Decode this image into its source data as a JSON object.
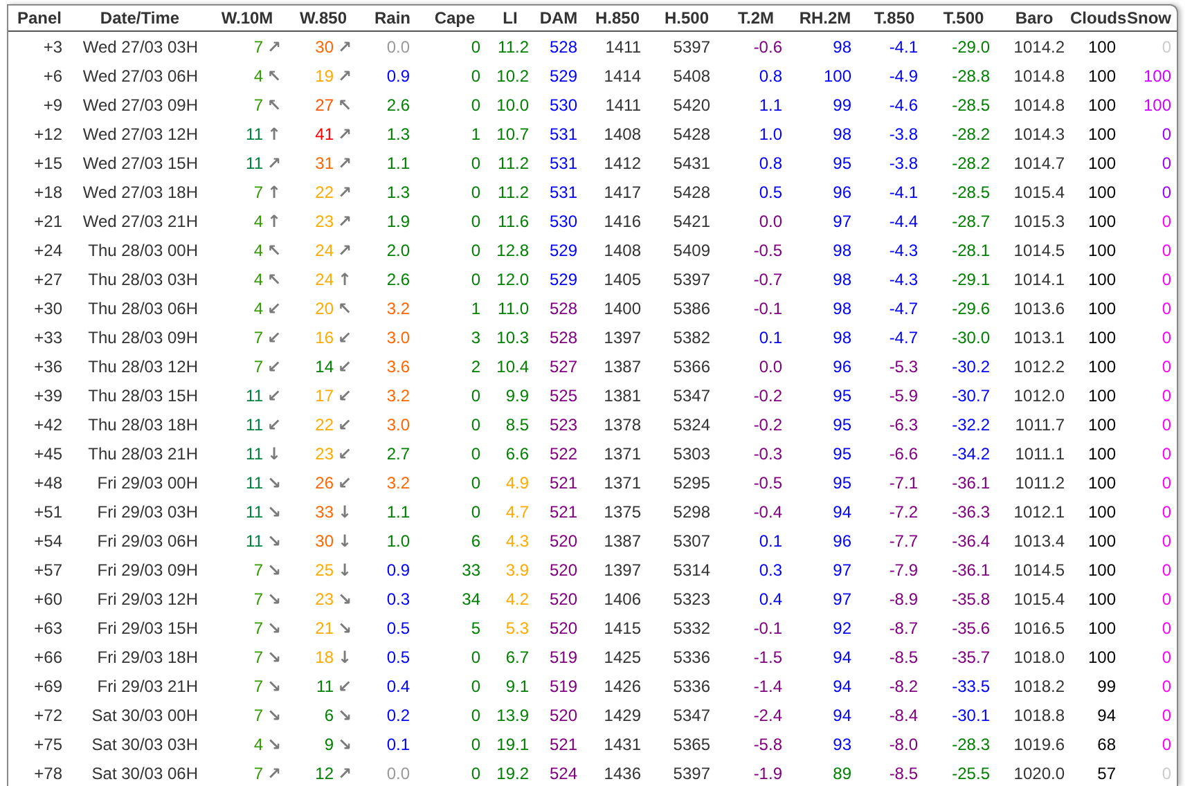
{
  "table": {
    "columns": [
      {
        "label": "Panel",
        "kind": "text"
      },
      {
        "label": "Date/Time",
        "kind": "text"
      },
      {
        "label": "W.10M",
        "kind": "wind"
      },
      {
        "label": "W.850",
        "kind": "wind"
      },
      {
        "label": "Rain",
        "kind": "text"
      },
      {
        "label": "Cape",
        "kind": "text"
      },
      {
        "label": "LI",
        "kind": "text"
      },
      {
        "label": "DAM",
        "kind": "text"
      },
      {
        "label": "H.850",
        "kind": "text"
      },
      {
        "label": "H.500",
        "kind": "text"
      },
      {
        "label": "T.2M",
        "kind": "text"
      },
      {
        "label": "RH.2M",
        "kind": "text"
      },
      {
        "label": "T.850",
        "kind": "text"
      },
      {
        "label": "T.500",
        "kind": "text"
      },
      {
        "label": "Baro",
        "kind": "text"
      },
      {
        "label": "Clouds",
        "kind": "text"
      },
      {
        "label": "Snow",
        "kind": "text"
      }
    ],
    "rows": [
      {
        "cells": [
          {
            "text": "+3"
          },
          {
            "text": "Wed 27/03 03H"
          },
          {
            "text": "7",
            "color": "#339900",
            "arrow": "↗"
          },
          {
            "text": "30",
            "color": "#ff6600",
            "arrow": "↗"
          },
          {
            "text": "0.0",
            "color": "#999999"
          },
          {
            "text": "0",
            "color": "#008000"
          },
          {
            "text": "11.2",
            "color": "#008000"
          },
          {
            "text": "528",
            "color": "#0000ff"
          },
          {
            "text": "1411"
          },
          {
            "text": "5397"
          },
          {
            "text": "-0.6",
            "color": "#800080"
          },
          {
            "text": "98",
            "color": "#0000ff"
          },
          {
            "text": "-4.1",
            "color": "#0000ff"
          },
          {
            "text": "-29.0",
            "color": "#008000"
          },
          {
            "text": "1014.2"
          },
          {
            "text": "100"
          },
          {
            "text": "0",
            "color": "#cccccc"
          }
        ]
      },
      {
        "cells": [
          {
            "text": "+6"
          },
          {
            "text": "Wed 27/03 06H"
          },
          {
            "text": "4",
            "color": "#339900",
            "arrow": "↖"
          },
          {
            "text": "19",
            "color": "#ffaa00",
            "arrow": "↗"
          },
          {
            "text": "0.9",
            "color": "#0000ff"
          },
          {
            "text": "0",
            "color": "#008000"
          },
          {
            "text": "10.2",
            "color": "#008000"
          },
          {
            "text": "529",
            "color": "#0000ff"
          },
          {
            "text": "1414"
          },
          {
            "text": "5408"
          },
          {
            "text": "0.8",
            "color": "#0000ff"
          },
          {
            "text": "100",
            "color": "#0000ff"
          },
          {
            "text": "-4.9",
            "color": "#0000ff"
          },
          {
            "text": "-28.8",
            "color": "#008000"
          },
          {
            "text": "1014.8"
          },
          {
            "text": "100"
          },
          {
            "text": "100",
            "color": "#cc00ff"
          }
        ]
      },
      {
        "cells": [
          {
            "text": "+9"
          },
          {
            "text": "Wed 27/03 09H"
          },
          {
            "text": "7",
            "color": "#339900",
            "arrow": "↖"
          },
          {
            "text": "27",
            "color": "#ff5500",
            "arrow": "↖"
          },
          {
            "text": "2.6",
            "color": "#008000"
          },
          {
            "text": "0",
            "color": "#008000"
          },
          {
            "text": "10.0",
            "color": "#008000"
          },
          {
            "text": "530",
            "color": "#0000ff"
          },
          {
            "text": "1411"
          },
          {
            "text": "5420"
          },
          {
            "text": "1.1",
            "color": "#0000ff"
          },
          {
            "text": "99",
            "color": "#0000ff"
          },
          {
            "text": "-4.6",
            "color": "#0000ff"
          },
          {
            "text": "-28.5",
            "color": "#008000"
          },
          {
            "text": "1014.8"
          },
          {
            "text": "100"
          },
          {
            "text": "100",
            "color": "#cc00ff"
          }
        ]
      },
      {
        "cells": [
          {
            "text": "+12"
          },
          {
            "text": "Wed 27/03 12H"
          },
          {
            "text": "11",
            "color": "#008040",
            "arrow": "↑"
          },
          {
            "text": "41",
            "color": "#ff0000",
            "arrow": "↗"
          },
          {
            "text": "1.3",
            "color": "#008000"
          },
          {
            "text": "1",
            "color": "#008000"
          },
          {
            "text": "10.7",
            "color": "#008000"
          },
          {
            "text": "531",
            "color": "#0000ff"
          },
          {
            "text": "1408"
          },
          {
            "text": "5428"
          },
          {
            "text": "1.0",
            "color": "#0000ff"
          },
          {
            "text": "98",
            "color": "#0000ff"
          },
          {
            "text": "-3.8",
            "color": "#0000ff"
          },
          {
            "text": "-28.2",
            "color": "#008000"
          },
          {
            "text": "1014.3"
          },
          {
            "text": "100"
          },
          {
            "text": "0",
            "color": "#a000ff"
          }
        ]
      },
      {
        "cells": [
          {
            "text": "+15"
          },
          {
            "text": "Wed 27/03 15H"
          },
          {
            "text": "11",
            "color": "#008040",
            "arrow": "↗"
          },
          {
            "text": "31",
            "color": "#ff6600",
            "arrow": "↗"
          },
          {
            "text": "1.1",
            "color": "#008000"
          },
          {
            "text": "0",
            "color": "#008000"
          },
          {
            "text": "11.2",
            "color": "#008000"
          },
          {
            "text": "531",
            "color": "#0000ff"
          },
          {
            "text": "1412"
          },
          {
            "text": "5431"
          },
          {
            "text": "0.8",
            "color": "#0000ff"
          },
          {
            "text": "95",
            "color": "#0000ff"
          },
          {
            "text": "-3.8",
            "color": "#0000ff"
          },
          {
            "text": "-28.2",
            "color": "#008000"
          },
          {
            "text": "1014.7"
          },
          {
            "text": "100"
          },
          {
            "text": "0",
            "color": "#a000ff"
          }
        ]
      },
      {
        "cells": [
          {
            "text": "+18"
          },
          {
            "text": "Wed 27/03 18H"
          },
          {
            "text": "7",
            "color": "#339900",
            "arrow": "↑"
          },
          {
            "text": "22",
            "color": "#ffaa00",
            "arrow": "↗"
          },
          {
            "text": "1.3",
            "color": "#008000"
          },
          {
            "text": "0",
            "color": "#008000"
          },
          {
            "text": "11.2",
            "color": "#008000"
          },
          {
            "text": "531",
            "color": "#0000ff"
          },
          {
            "text": "1417"
          },
          {
            "text": "5428"
          },
          {
            "text": "0.5",
            "color": "#0000ff"
          },
          {
            "text": "96",
            "color": "#0000ff"
          },
          {
            "text": "-4.1",
            "color": "#0000ff"
          },
          {
            "text": "-28.5",
            "color": "#008000"
          },
          {
            "text": "1015.4"
          },
          {
            "text": "100"
          },
          {
            "text": "0",
            "color": "#a000ff"
          }
        ]
      },
      {
        "cells": [
          {
            "text": "+21"
          },
          {
            "text": "Wed 27/03 21H"
          },
          {
            "text": "4",
            "color": "#339900",
            "arrow": "↑"
          },
          {
            "text": "23",
            "color": "#ffaa00",
            "arrow": "↗"
          },
          {
            "text": "1.9",
            "color": "#008000"
          },
          {
            "text": "0",
            "color": "#008000"
          },
          {
            "text": "11.6",
            "color": "#008000"
          },
          {
            "text": "530",
            "color": "#0000ff"
          },
          {
            "text": "1416"
          },
          {
            "text": "5421"
          },
          {
            "text": "0.0",
            "color": "#800080"
          },
          {
            "text": "97",
            "color": "#0000ff"
          },
          {
            "text": "-4.4",
            "color": "#0000ff"
          },
          {
            "text": "-28.7",
            "color": "#008000"
          },
          {
            "text": "1015.3"
          },
          {
            "text": "100"
          },
          {
            "text": "0",
            "color": "#ff00ff"
          }
        ]
      },
      {
        "cells": [
          {
            "text": "+24"
          },
          {
            "text": "Thu 28/03 00H"
          },
          {
            "text": "4",
            "color": "#339900",
            "arrow": "↖"
          },
          {
            "text": "24",
            "color": "#ffaa00",
            "arrow": "↗"
          },
          {
            "text": "2.0",
            "color": "#008000"
          },
          {
            "text": "0",
            "color": "#008000"
          },
          {
            "text": "12.8",
            "color": "#008000"
          },
          {
            "text": "529",
            "color": "#0000ff"
          },
          {
            "text": "1408"
          },
          {
            "text": "5409"
          },
          {
            "text": "-0.5",
            "color": "#800080"
          },
          {
            "text": "98",
            "color": "#0000ff"
          },
          {
            "text": "-4.3",
            "color": "#0000ff"
          },
          {
            "text": "-28.1",
            "color": "#008000"
          },
          {
            "text": "1014.5"
          },
          {
            "text": "100"
          },
          {
            "text": "0",
            "color": "#ff00ff"
          }
        ]
      },
      {
        "cells": [
          {
            "text": "+27"
          },
          {
            "text": "Thu 28/03 03H"
          },
          {
            "text": "4",
            "color": "#339900",
            "arrow": "↖"
          },
          {
            "text": "24",
            "color": "#ffaa00",
            "arrow": "↑"
          },
          {
            "text": "2.6",
            "color": "#008000"
          },
          {
            "text": "0",
            "color": "#008000"
          },
          {
            "text": "12.0",
            "color": "#008000"
          },
          {
            "text": "529",
            "color": "#0000ff"
          },
          {
            "text": "1405"
          },
          {
            "text": "5397"
          },
          {
            "text": "-0.7",
            "color": "#800080"
          },
          {
            "text": "98",
            "color": "#0000ff"
          },
          {
            "text": "-4.3",
            "color": "#0000ff"
          },
          {
            "text": "-29.1",
            "color": "#008000"
          },
          {
            "text": "1014.1"
          },
          {
            "text": "100"
          },
          {
            "text": "0",
            "color": "#ff00ff"
          }
        ]
      },
      {
        "cells": [
          {
            "text": "+30"
          },
          {
            "text": "Thu 28/03 06H"
          },
          {
            "text": "4",
            "color": "#339900",
            "arrow": "↙"
          },
          {
            "text": "20",
            "color": "#ffaa00",
            "arrow": "↖"
          },
          {
            "text": "3.2",
            "color": "#ff6600"
          },
          {
            "text": "1",
            "color": "#008000"
          },
          {
            "text": "11.0",
            "color": "#008000"
          },
          {
            "text": "528",
            "color": "#800080"
          },
          {
            "text": "1400"
          },
          {
            "text": "5386"
          },
          {
            "text": "-0.1",
            "color": "#800080"
          },
          {
            "text": "98",
            "color": "#0000ff"
          },
          {
            "text": "-4.7",
            "color": "#0000ff"
          },
          {
            "text": "-29.6",
            "color": "#008000"
          },
          {
            "text": "1013.6"
          },
          {
            "text": "100"
          },
          {
            "text": "0",
            "color": "#ff00ff"
          }
        ]
      },
      {
        "cells": [
          {
            "text": "+33"
          },
          {
            "text": "Thu 28/03 09H"
          },
          {
            "text": "7",
            "color": "#339900",
            "arrow": "↙"
          },
          {
            "text": "16",
            "color": "#ffaa00",
            "arrow": "↙"
          },
          {
            "text": "3.0",
            "color": "#ff6600"
          },
          {
            "text": "3",
            "color": "#008000"
          },
          {
            "text": "10.3",
            "color": "#008000"
          },
          {
            "text": "528",
            "color": "#800080"
          },
          {
            "text": "1397"
          },
          {
            "text": "5382"
          },
          {
            "text": "0.1",
            "color": "#0000ff"
          },
          {
            "text": "98",
            "color": "#0000ff"
          },
          {
            "text": "-4.7",
            "color": "#0000ff"
          },
          {
            "text": "-30.0",
            "color": "#008000"
          },
          {
            "text": "1013.1"
          },
          {
            "text": "100"
          },
          {
            "text": "0",
            "color": "#ff00ff"
          }
        ]
      },
      {
        "cells": [
          {
            "text": "+36"
          },
          {
            "text": "Thu 28/03 12H"
          },
          {
            "text": "7",
            "color": "#339900",
            "arrow": "↙"
          },
          {
            "text": "14",
            "color": "#008000",
            "arrow": "↙"
          },
          {
            "text": "3.6",
            "color": "#ff6600"
          },
          {
            "text": "2",
            "color": "#008000"
          },
          {
            "text": "10.4",
            "color": "#008000"
          },
          {
            "text": "527",
            "color": "#800080"
          },
          {
            "text": "1387"
          },
          {
            "text": "5366"
          },
          {
            "text": "0.0",
            "color": "#800080"
          },
          {
            "text": "96",
            "color": "#0000ff"
          },
          {
            "text": "-5.3",
            "color": "#800080"
          },
          {
            "text": "-30.2",
            "color": "#0000ff"
          },
          {
            "text": "1012.2"
          },
          {
            "text": "100"
          },
          {
            "text": "0",
            "color": "#ff00ff"
          }
        ]
      },
      {
        "cells": [
          {
            "text": "+39"
          },
          {
            "text": "Thu 28/03 15H"
          },
          {
            "text": "11",
            "color": "#008040",
            "arrow": "↙"
          },
          {
            "text": "17",
            "color": "#ffaa00",
            "arrow": "↙"
          },
          {
            "text": "3.2",
            "color": "#ff6600"
          },
          {
            "text": "0",
            "color": "#008000"
          },
          {
            "text": "9.9",
            "color": "#008000"
          },
          {
            "text": "525",
            "color": "#800080"
          },
          {
            "text": "1381"
          },
          {
            "text": "5347"
          },
          {
            "text": "-0.2",
            "color": "#800080"
          },
          {
            "text": "95",
            "color": "#0000ff"
          },
          {
            "text": "-5.9",
            "color": "#800080"
          },
          {
            "text": "-30.7",
            "color": "#0000ff"
          },
          {
            "text": "1012.0"
          },
          {
            "text": "100"
          },
          {
            "text": "0",
            "color": "#ff00ff"
          }
        ]
      },
      {
        "cells": [
          {
            "text": "+42"
          },
          {
            "text": "Thu 28/03 18H"
          },
          {
            "text": "11",
            "color": "#008040",
            "arrow": "↙"
          },
          {
            "text": "22",
            "color": "#ffaa00",
            "arrow": "↙"
          },
          {
            "text": "3.0",
            "color": "#ff6600"
          },
          {
            "text": "0",
            "color": "#008000"
          },
          {
            "text": "8.5",
            "color": "#008000"
          },
          {
            "text": "523",
            "color": "#800080"
          },
          {
            "text": "1378"
          },
          {
            "text": "5324"
          },
          {
            "text": "-0.2",
            "color": "#800080"
          },
          {
            "text": "95",
            "color": "#0000ff"
          },
          {
            "text": "-6.3",
            "color": "#800080"
          },
          {
            "text": "-32.2",
            "color": "#0000ff"
          },
          {
            "text": "1011.7"
          },
          {
            "text": "100"
          },
          {
            "text": "0",
            "color": "#ff00ff"
          }
        ]
      },
      {
        "cells": [
          {
            "text": "+45"
          },
          {
            "text": "Thu 28/03 21H"
          },
          {
            "text": "11",
            "color": "#008040",
            "arrow": "↓"
          },
          {
            "text": "23",
            "color": "#ffaa00",
            "arrow": "↙"
          },
          {
            "text": "2.7",
            "color": "#008000"
          },
          {
            "text": "0",
            "color": "#008000"
          },
          {
            "text": "6.6",
            "color": "#008000"
          },
          {
            "text": "522",
            "color": "#800080"
          },
          {
            "text": "1371"
          },
          {
            "text": "5303"
          },
          {
            "text": "-0.3",
            "color": "#800080"
          },
          {
            "text": "95",
            "color": "#0000ff"
          },
          {
            "text": "-6.6",
            "color": "#800080"
          },
          {
            "text": "-34.2",
            "color": "#0000ff"
          },
          {
            "text": "1011.1"
          },
          {
            "text": "100"
          },
          {
            "text": "0",
            "color": "#ff00ff"
          }
        ]
      },
      {
        "cells": [
          {
            "text": "+48"
          },
          {
            "text": "Fri 29/03 00H"
          },
          {
            "text": "11",
            "color": "#008040",
            "arrow": "↘"
          },
          {
            "text": "26",
            "color": "#ff6600",
            "arrow": "↙"
          },
          {
            "text": "3.2",
            "color": "#ff6600"
          },
          {
            "text": "0",
            "color": "#008000"
          },
          {
            "text": "4.9",
            "color": "#ffaa00"
          },
          {
            "text": "521",
            "color": "#800080"
          },
          {
            "text": "1371"
          },
          {
            "text": "5295"
          },
          {
            "text": "-0.5",
            "color": "#800080"
          },
          {
            "text": "95",
            "color": "#0000ff"
          },
          {
            "text": "-7.1",
            "color": "#800080"
          },
          {
            "text": "-36.1",
            "color": "#800080"
          },
          {
            "text": "1011.2"
          },
          {
            "text": "100"
          },
          {
            "text": "0",
            "color": "#ff00ff"
          }
        ]
      },
      {
        "cells": [
          {
            "text": "+51"
          },
          {
            "text": "Fri 29/03 03H"
          },
          {
            "text": "11",
            "color": "#008040",
            "arrow": "↘"
          },
          {
            "text": "33",
            "color": "#ff6600",
            "arrow": "↓"
          },
          {
            "text": "1.1",
            "color": "#008000"
          },
          {
            "text": "0",
            "color": "#008000"
          },
          {
            "text": "4.7",
            "color": "#ffaa00"
          },
          {
            "text": "521",
            "color": "#800080"
          },
          {
            "text": "1375"
          },
          {
            "text": "5298"
          },
          {
            "text": "-0.4",
            "color": "#800080"
          },
          {
            "text": "94",
            "color": "#0000ff"
          },
          {
            "text": "-7.2",
            "color": "#800080"
          },
          {
            "text": "-36.3",
            "color": "#800080"
          },
          {
            "text": "1012.1"
          },
          {
            "text": "100"
          },
          {
            "text": "0",
            "color": "#ff00ff"
          }
        ]
      },
      {
        "cells": [
          {
            "text": "+54"
          },
          {
            "text": "Fri 29/03 06H"
          },
          {
            "text": "11",
            "color": "#008040",
            "arrow": "↘"
          },
          {
            "text": "30",
            "color": "#ff6600",
            "arrow": "↓"
          },
          {
            "text": "1.0",
            "color": "#008000"
          },
          {
            "text": "6",
            "color": "#008000"
          },
          {
            "text": "4.3",
            "color": "#ffaa00"
          },
          {
            "text": "520",
            "color": "#800080"
          },
          {
            "text": "1387"
          },
          {
            "text": "5307"
          },
          {
            "text": "0.1",
            "color": "#0000ff"
          },
          {
            "text": "96",
            "color": "#0000ff"
          },
          {
            "text": "-7.7",
            "color": "#800080"
          },
          {
            "text": "-36.4",
            "color": "#800080"
          },
          {
            "text": "1013.4"
          },
          {
            "text": "100"
          },
          {
            "text": "0",
            "color": "#ff00ff"
          }
        ]
      },
      {
        "cells": [
          {
            "text": "+57"
          },
          {
            "text": "Fri 29/03 09H"
          },
          {
            "text": "7",
            "color": "#339900",
            "arrow": "↘"
          },
          {
            "text": "25",
            "color": "#ffaa00",
            "arrow": "↓"
          },
          {
            "text": "0.9",
            "color": "#0000ff"
          },
          {
            "text": "33",
            "color": "#008000"
          },
          {
            "text": "3.9",
            "color": "#ffaa00"
          },
          {
            "text": "520",
            "color": "#800080"
          },
          {
            "text": "1397"
          },
          {
            "text": "5314"
          },
          {
            "text": "0.3",
            "color": "#0000ff"
          },
          {
            "text": "97",
            "color": "#0000ff"
          },
          {
            "text": "-7.9",
            "color": "#800080"
          },
          {
            "text": "-36.1",
            "color": "#800080"
          },
          {
            "text": "1014.5"
          },
          {
            "text": "100"
          },
          {
            "text": "0",
            "color": "#ff00ff"
          }
        ]
      },
      {
        "cells": [
          {
            "text": "+60"
          },
          {
            "text": "Fri 29/03 12H"
          },
          {
            "text": "7",
            "color": "#339900",
            "arrow": "↘"
          },
          {
            "text": "23",
            "color": "#ffaa00",
            "arrow": "↘"
          },
          {
            "text": "0.3",
            "color": "#0000ff"
          },
          {
            "text": "34",
            "color": "#008000"
          },
          {
            "text": "4.2",
            "color": "#ffaa00"
          },
          {
            "text": "520",
            "color": "#800080"
          },
          {
            "text": "1406"
          },
          {
            "text": "5323"
          },
          {
            "text": "0.4",
            "color": "#0000ff"
          },
          {
            "text": "97",
            "color": "#0000ff"
          },
          {
            "text": "-8.9",
            "color": "#800080"
          },
          {
            "text": "-35.8",
            "color": "#800080"
          },
          {
            "text": "1015.4"
          },
          {
            "text": "100"
          },
          {
            "text": "0",
            "color": "#ff00ff"
          }
        ]
      },
      {
        "cells": [
          {
            "text": "+63"
          },
          {
            "text": "Fri 29/03 15H"
          },
          {
            "text": "7",
            "color": "#339900",
            "arrow": "↘"
          },
          {
            "text": "21",
            "color": "#ffaa00",
            "arrow": "↘"
          },
          {
            "text": "0.5",
            "color": "#0000ff"
          },
          {
            "text": "5",
            "color": "#008000"
          },
          {
            "text": "5.3",
            "color": "#ffaa00"
          },
          {
            "text": "520",
            "color": "#800080"
          },
          {
            "text": "1415"
          },
          {
            "text": "5332"
          },
          {
            "text": "-0.1",
            "color": "#800080"
          },
          {
            "text": "92",
            "color": "#0000ff"
          },
          {
            "text": "-8.7",
            "color": "#800080"
          },
          {
            "text": "-35.6",
            "color": "#800080"
          },
          {
            "text": "1016.5"
          },
          {
            "text": "100"
          },
          {
            "text": "0",
            "color": "#ff00ff"
          }
        ]
      },
      {
        "cells": [
          {
            "text": "+66"
          },
          {
            "text": "Fri 29/03 18H"
          },
          {
            "text": "7",
            "color": "#339900",
            "arrow": "↘"
          },
          {
            "text": "18",
            "color": "#ffaa00",
            "arrow": "↓"
          },
          {
            "text": "0.5",
            "color": "#0000ff"
          },
          {
            "text": "0",
            "color": "#008000"
          },
          {
            "text": "6.7",
            "color": "#008000"
          },
          {
            "text": "519",
            "color": "#800080"
          },
          {
            "text": "1425"
          },
          {
            "text": "5336"
          },
          {
            "text": "-1.5",
            "color": "#800080"
          },
          {
            "text": "94",
            "color": "#0000ff"
          },
          {
            "text": "-8.5",
            "color": "#800080"
          },
          {
            "text": "-35.7",
            "color": "#800080"
          },
          {
            "text": "1018.0"
          },
          {
            "text": "100"
          },
          {
            "text": "0",
            "color": "#ff00ff"
          }
        ]
      },
      {
        "cells": [
          {
            "text": "+69"
          },
          {
            "text": "Fri 29/03 21H"
          },
          {
            "text": "7",
            "color": "#339900",
            "arrow": "↘"
          },
          {
            "text": "11",
            "color": "#008000",
            "arrow": "↙"
          },
          {
            "text": "0.4",
            "color": "#0000ff"
          },
          {
            "text": "0",
            "color": "#008000"
          },
          {
            "text": "9.1",
            "color": "#008000"
          },
          {
            "text": "519",
            "color": "#800080"
          },
          {
            "text": "1426"
          },
          {
            "text": "5336"
          },
          {
            "text": "-1.4",
            "color": "#800080"
          },
          {
            "text": "94",
            "color": "#0000ff"
          },
          {
            "text": "-8.2",
            "color": "#800080"
          },
          {
            "text": "-33.5",
            "color": "#0000ff"
          },
          {
            "text": "1018.2"
          },
          {
            "text": "99"
          },
          {
            "text": "0",
            "color": "#ff00ff"
          }
        ]
      },
      {
        "cells": [
          {
            "text": "+72"
          },
          {
            "text": "Sat 30/03 00H"
          },
          {
            "text": "7",
            "color": "#339900",
            "arrow": "↘"
          },
          {
            "text": "6",
            "color": "#008000",
            "arrow": "↘"
          },
          {
            "text": "0.2",
            "color": "#0000ff"
          },
          {
            "text": "0",
            "color": "#008000"
          },
          {
            "text": "13.9",
            "color": "#008000"
          },
          {
            "text": "520",
            "color": "#800080"
          },
          {
            "text": "1429"
          },
          {
            "text": "5347"
          },
          {
            "text": "-2.4",
            "color": "#800080"
          },
          {
            "text": "94",
            "color": "#0000ff"
          },
          {
            "text": "-8.4",
            "color": "#800080"
          },
          {
            "text": "-30.1",
            "color": "#0000ff"
          },
          {
            "text": "1018.8"
          },
          {
            "text": "94"
          },
          {
            "text": "0",
            "color": "#ff00ff"
          }
        ]
      },
      {
        "cells": [
          {
            "text": "+75"
          },
          {
            "text": "Sat 30/03 03H"
          },
          {
            "text": "4",
            "color": "#339900",
            "arrow": "↘"
          },
          {
            "text": "9",
            "color": "#008000",
            "arrow": "↘"
          },
          {
            "text": "0.1",
            "color": "#0000ff"
          },
          {
            "text": "0",
            "color": "#008000"
          },
          {
            "text": "19.1",
            "color": "#008000"
          },
          {
            "text": "521",
            "color": "#800080"
          },
          {
            "text": "1431"
          },
          {
            "text": "5365"
          },
          {
            "text": "-5.8",
            "color": "#800080"
          },
          {
            "text": "93",
            "color": "#0000ff"
          },
          {
            "text": "-8.0",
            "color": "#800080"
          },
          {
            "text": "-28.3",
            "color": "#008000"
          },
          {
            "text": "1019.6"
          },
          {
            "text": "68"
          },
          {
            "text": "0",
            "color": "#ff00ff"
          }
        ]
      },
      {
        "cells": [
          {
            "text": "+78"
          },
          {
            "text": "Sat 30/03 06H"
          },
          {
            "text": "7",
            "color": "#339900",
            "arrow": "↗"
          },
          {
            "text": "12",
            "color": "#008000",
            "arrow": "↗"
          },
          {
            "text": "0.0",
            "color": "#999999"
          },
          {
            "text": "0",
            "color": "#008000"
          },
          {
            "text": "19.2",
            "color": "#008000"
          },
          {
            "text": "524",
            "color": "#800080"
          },
          {
            "text": "1436"
          },
          {
            "text": "5397"
          },
          {
            "text": "-1.9",
            "color": "#800080"
          },
          {
            "text": "89",
            "color": "#008000"
          },
          {
            "text": "-8.5",
            "color": "#800080"
          },
          {
            "text": "-25.5",
            "color": "#008000"
          },
          {
            "text": "1020.0"
          },
          {
            "text": "57"
          },
          {
            "text": "0",
            "color": "#cccccc"
          }
        ]
      }
    ]
  }
}
